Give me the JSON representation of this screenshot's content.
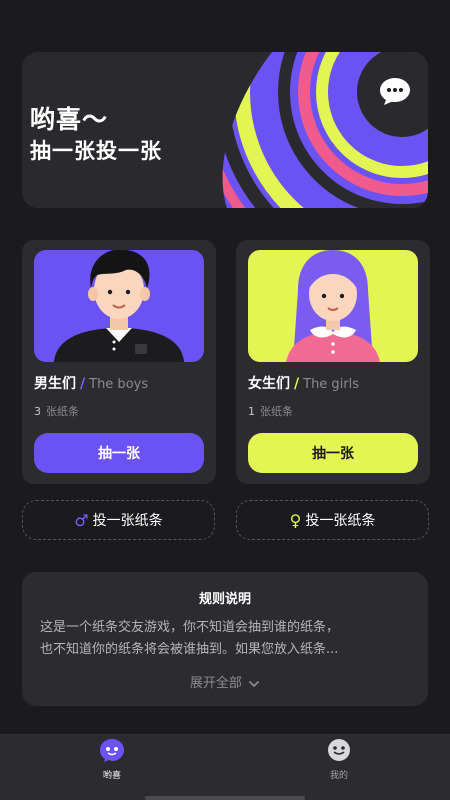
{
  "banner": {
    "title": "哟喜～",
    "subtitle": "抽一张投一张"
  },
  "cards": {
    "boys": {
      "name": "男生们",
      "name_en": "The boys",
      "count": "3",
      "count_unit": "张纸条",
      "button": "抽一张"
    },
    "girls": {
      "name": "女生们",
      "name_en": "The girls",
      "count": "1",
      "count_unit": "张纸条",
      "button": "抽一张"
    }
  },
  "drop": {
    "male_symbol": "♂",
    "male_label": "投一张纸条",
    "female_symbol": "♀",
    "female_label": "投一张纸条"
  },
  "rules": {
    "title": "规则说明",
    "line1": "这是一个纸条交友游戏，你不知道会抽到谁的纸条，",
    "line2": "也不知道你的纸条将会被谁抽到。如果您放入纸条...",
    "expand": "展开全部"
  },
  "tabbar": {
    "home": "哟喜",
    "mine": "我的"
  },
  "colors": {
    "background": "#1b1b1e",
    "card": "#2c2c30",
    "purple": "#6b52f2",
    "lime": "#e3f552",
    "pink": "#f05a8c"
  },
  "icons": {
    "banner": "chat-bubble-icon",
    "expand": "chevron-down-icon",
    "home_tab": "smiley-bubble-icon",
    "mine_tab": "smiley-face-icon"
  }
}
